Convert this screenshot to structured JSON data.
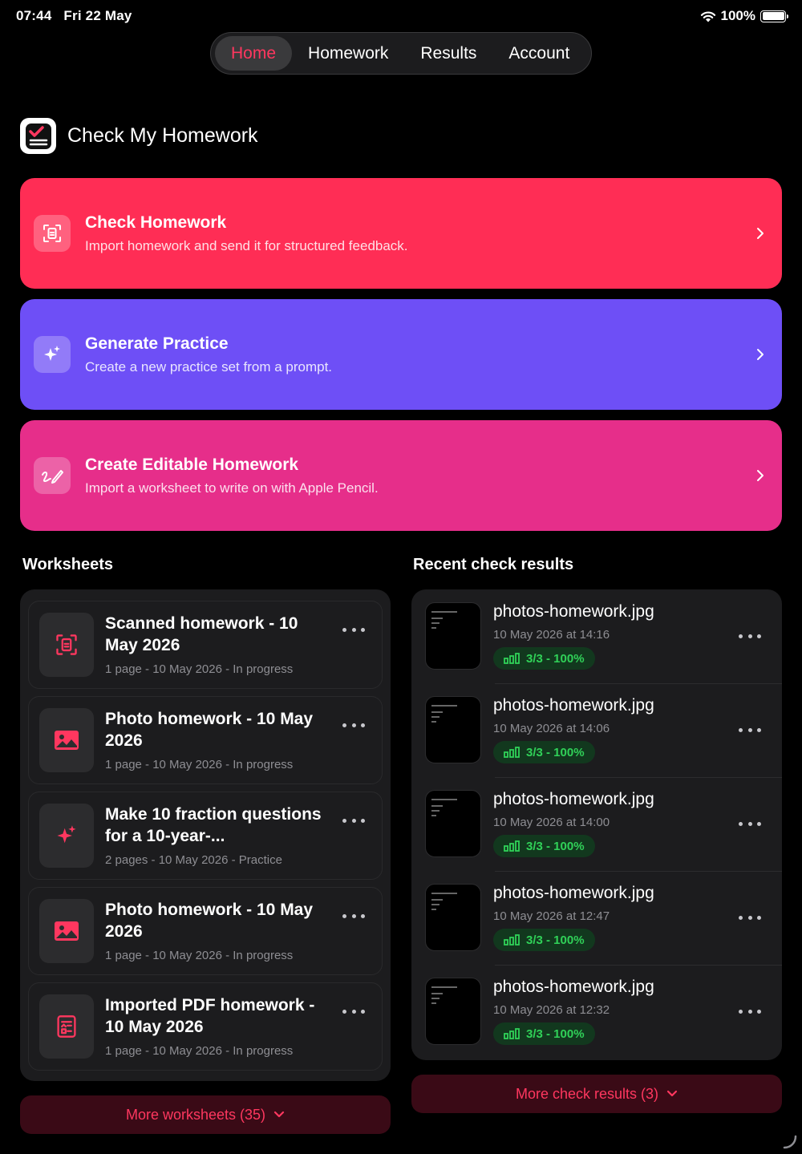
{
  "status_bar": {
    "time": "07:44",
    "date": "Fri 22 May",
    "battery": "100%"
  },
  "tabs": [
    {
      "label": "Home",
      "active": true
    },
    {
      "label": "Homework",
      "active": false
    },
    {
      "label": "Results",
      "active": false
    },
    {
      "label": "Account",
      "active": false
    }
  ],
  "app": {
    "title": "Check My Homework"
  },
  "actions": [
    {
      "title": "Check Homework",
      "subtitle": "Import homework and send it for structured feedback.",
      "icon": "document-scan-icon",
      "color": "#ff2d55"
    },
    {
      "title": "Generate Practice",
      "subtitle": "Create a new practice set from a prompt.",
      "icon": "sparkles-icon",
      "color": "#6e4ff6"
    },
    {
      "title": "Create Editable Homework",
      "subtitle": "Import a worksheet to write on with Apple Pencil.",
      "icon": "pencil-scribble-icon",
      "color": "#e62e8a"
    }
  ],
  "worksheets": {
    "title": "Worksheets",
    "items": [
      {
        "title": "Scanned homework - 10 May 2026",
        "meta": "1 page - 10 May 2026 - In progress",
        "icon": "document-scan-icon"
      },
      {
        "title": "Photo homework - 10 May 2026",
        "meta": "1 page - 10 May 2026 - In progress",
        "icon": "photo-icon"
      },
      {
        "title": "Make 10 fraction questions for a 10-year-...",
        "meta": "2 pages - 10 May 2026 - Practice",
        "icon": "sparkles-icon"
      },
      {
        "title": "Photo homework - 10 May 2026",
        "meta": "1 page - 10 May 2026 - In progress",
        "icon": "photo-icon"
      },
      {
        "title": "Imported PDF homework - 10 May 2026",
        "meta": "1 page - 10 May 2026 - In progress",
        "icon": "pdf-document-icon"
      }
    ],
    "more_label": "More worksheets (35)"
  },
  "results": {
    "title": "Recent check results",
    "items": [
      {
        "title": "photos-homework.jpg",
        "date": "10 May 2026 at 14:16",
        "score": "3/3 - 100%"
      },
      {
        "title": "photos-homework.jpg",
        "date": "10 May 2026 at 14:06",
        "score": "3/3 - 100%"
      },
      {
        "title": "photos-homework.jpg",
        "date": "10 May 2026 at 14:00",
        "score": "3/3 - 100%"
      },
      {
        "title": "photos-homework.jpg",
        "date": "10 May 2026 at 12:47",
        "score": "3/3 - 100%"
      },
      {
        "title": "photos-homework.jpg",
        "date": "10 May 2026 at 12:32",
        "score": "3/3 - 100%"
      }
    ],
    "more_label": "More check results (3)"
  },
  "colors": {
    "accent": "#ff375f",
    "success": "#30d158",
    "panel": "#1c1c1e"
  }
}
